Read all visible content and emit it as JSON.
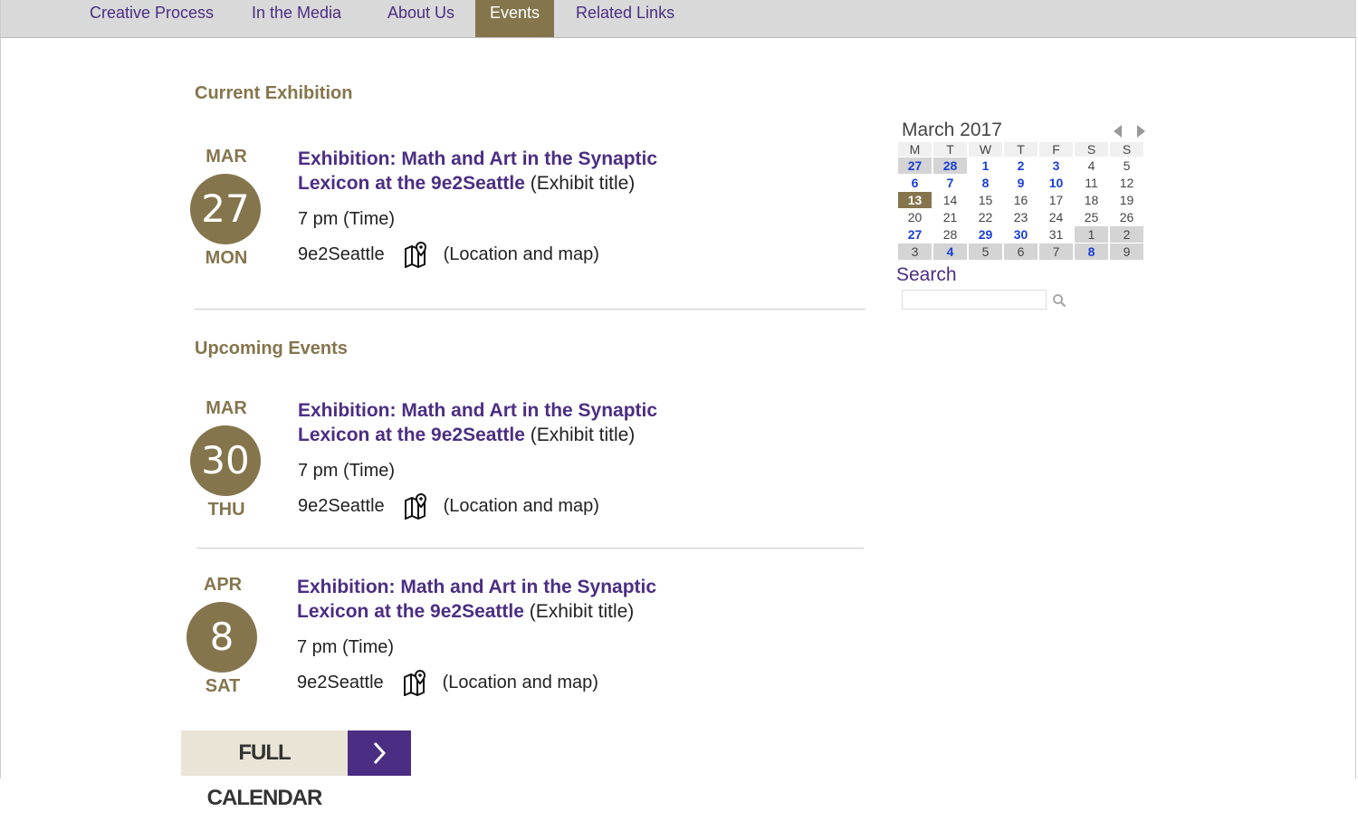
{
  "nav": {
    "items": [
      "Creative Process",
      "In the Media",
      "About Us",
      "Events",
      "Related Links"
    ],
    "active": "Events"
  },
  "sections": {
    "current": "Current Exhibition",
    "upcoming": "Upcoming Events"
  },
  "events": [
    {
      "month": "MAR",
      "day": "27",
      "dow": "MON",
      "title": "Exhibition: Math and Art in the Synaptic Lexicon at the 9e2Seattle",
      "title_suffix": " (Exhibit title)",
      "time": "7 pm (Time)",
      "location": "9e2Seattle",
      "location_suffix": "(Location and map)"
    },
    {
      "month": "MAR",
      "day": "30",
      "dow": "THU",
      "title": "Exhibition: Math and Art in the Synaptic Lexicon at the 9e2Seattle",
      "title_suffix": " (Exhibit title)",
      "time": "7 pm (Time)",
      "location": "9e2Seattle",
      "location_suffix": "(Location and map)"
    },
    {
      "month": "APR",
      "day": "8",
      "dow": "SAT",
      "title": "Exhibition: Math and Art in the Synaptic Lexicon at the 9e2Seattle",
      "title_suffix": " (Exhibit title)",
      "time": "7 pm (Time)",
      "location": "9e2Seattle",
      "location_suffix": "(Location and map)"
    }
  ],
  "calendar": {
    "title": "March 2017",
    "weekdays": [
      "M",
      "T",
      "W",
      "T",
      "F",
      "S",
      "S"
    ],
    "weeks": [
      [
        {
          "d": "27",
          "t": "other-ev"
        },
        {
          "d": "28",
          "t": "other-ev"
        },
        {
          "d": "1",
          "t": "ev"
        },
        {
          "d": "2",
          "t": "ev"
        },
        {
          "d": "3",
          "t": "ev"
        },
        {
          "d": "4",
          "t": ""
        },
        {
          "d": "5",
          "t": ""
        }
      ],
      [
        {
          "d": "6",
          "t": "ev"
        },
        {
          "d": "7",
          "t": "ev"
        },
        {
          "d": "8",
          "t": "ev"
        },
        {
          "d": "9",
          "t": "ev"
        },
        {
          "d": "10",
          "t": "ev"
        },
        {
          "d": "11",
          "t": ""
        },
        {
          "d": "12",
          "t": ""
        }
      ],
      [
        {
          "d": "13",
          "t": "today"
        },
        {
          "d": "14",
          "t": ""
        },
        {
          "d": "15",
          "t": ""
        },
        {
          "d": "16",
          "t": ""
        },
        {
          "d": "17",
          "t": ""
        },
        {
          "d": "18",
          "t": ""
        },
        {
          "d": "19",
          "t": ""
        }
      ],
      [
        {
          "d": "20",
          "t": ""
        },
        {
          "d": "21",
          "t": ""
        },
        {
          "d": "22",
          "t": ""
        },
        {
          "d": "23",
          "t": ""
        },
        {
          "d": "24",
          "t": ""
        },
        {
          "d": "25",
          "t": ""
        },
        {
          "d": "26",
          "t": ""
        }
      ],
      [
        {
          "d": "27",
          "t": "ev"
        },
        {
          "d": "28",
          "t": ""
        },
        {
          "d": "29",
          "t": "ev"
        },
        {
          "d": "30",
          "t": "ev"
        },
        {
          "d": "31",
          "t": ""
        },
        {
          "d": "1",
          "t": "other"
        },
        {
          "d": "2",
          "t": "other"
        }
      ],
      [
        {
          "d": "3",
          "t": "other"
        },
        {
          "d": "4",
          "t": "other-ev"
        },
        {
          "d": "5",
          "t": "other"
        },
        {
          "d": "6",
          "t": "other"
        },
        {
          "d": "7",
          "t": "other"
        },
        {
          "d": "8",
          "t": "other-ev"
        },
        {
          "d": "9",
          "t": "other"
        }
      ]
    ]
  },
  "search": {
    "label": "Search",
    "placeholder": ""
  },
  "full_calendar": {
    "label": "FULL CALENDAR"
  },
  "colors": {
    "gold": "#85754d",
    "purple": "#4b2e83",
    "event_link_blue": "#1a3fd6"
  }
}
